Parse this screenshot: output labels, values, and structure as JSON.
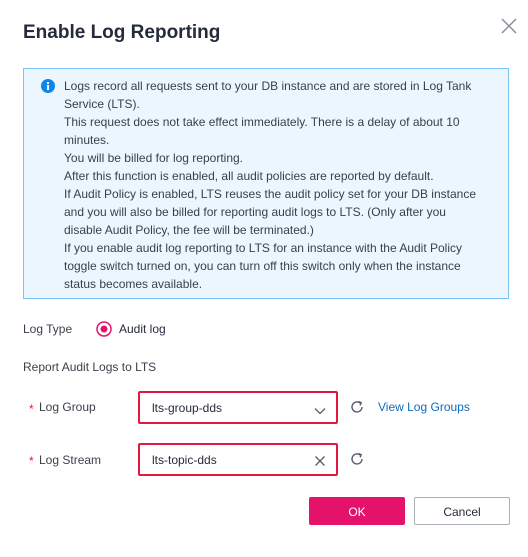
{
  "dialog": {
    "title": "Enable Log Reporting"
  },
  "info": {
    "lines": [
      "Logs record all requests sent to your DB instance and are stored in Log Tank",
      "Service (LTS).",
      "This request does not take effect immediately. There is a delay of about 10",
      "minutes.",
      "You will be billed for log reporting.",
      "After this function is enabled, all audit policies are reported by default.",
      "If Audit Policy is enabled, LTS reuses the audit policy set for your DB instance",
      "and you will also be billed for reporting audit logs to LTS. (Only after you",
      "disable Audit Policy, the fee will be terminated.)",
      "If you enable audit log reporting to LTS for an instance with the Audit Policy",
      "toggle switch turned on, you can turn off this switch only when the instance",
      "status becomes available."
    ]
  },
  "log_type": {
    "label": "Log Type",
    "option": "Audit log",
    "selected": true
  },
  "section": {
    "label": "Report Audit Logs to LTS"
  },
  "log_group": {
    "required_mark": "*",
    "label": "Log Group",
    "value": "lts-group-dds",
    "link": "View Log Groups"
  },
  "log_stream": {
    "required_mark": "*",
    "label": "Log Stream",
    "value": "lts-topic-dds"
  },
  "buttons": {
    "ok": "OK",
    "cancel": "Cancel"
  },
  "colors": {
    "accent": "#e5126b",
    "error_border": "#e5173f",
    "info_bg": "#ebf6ff",
    "info_border": "#7cc2f4",
    "link": "#0f6bbd"
  },
  "icons": {
    "close": "close-icon",
    "info": "info-icon",
    "dropdown": "chevron-down-icon",
    "refresh": "refresh-icon",
    "clear": "clear-icon"
  }
}
